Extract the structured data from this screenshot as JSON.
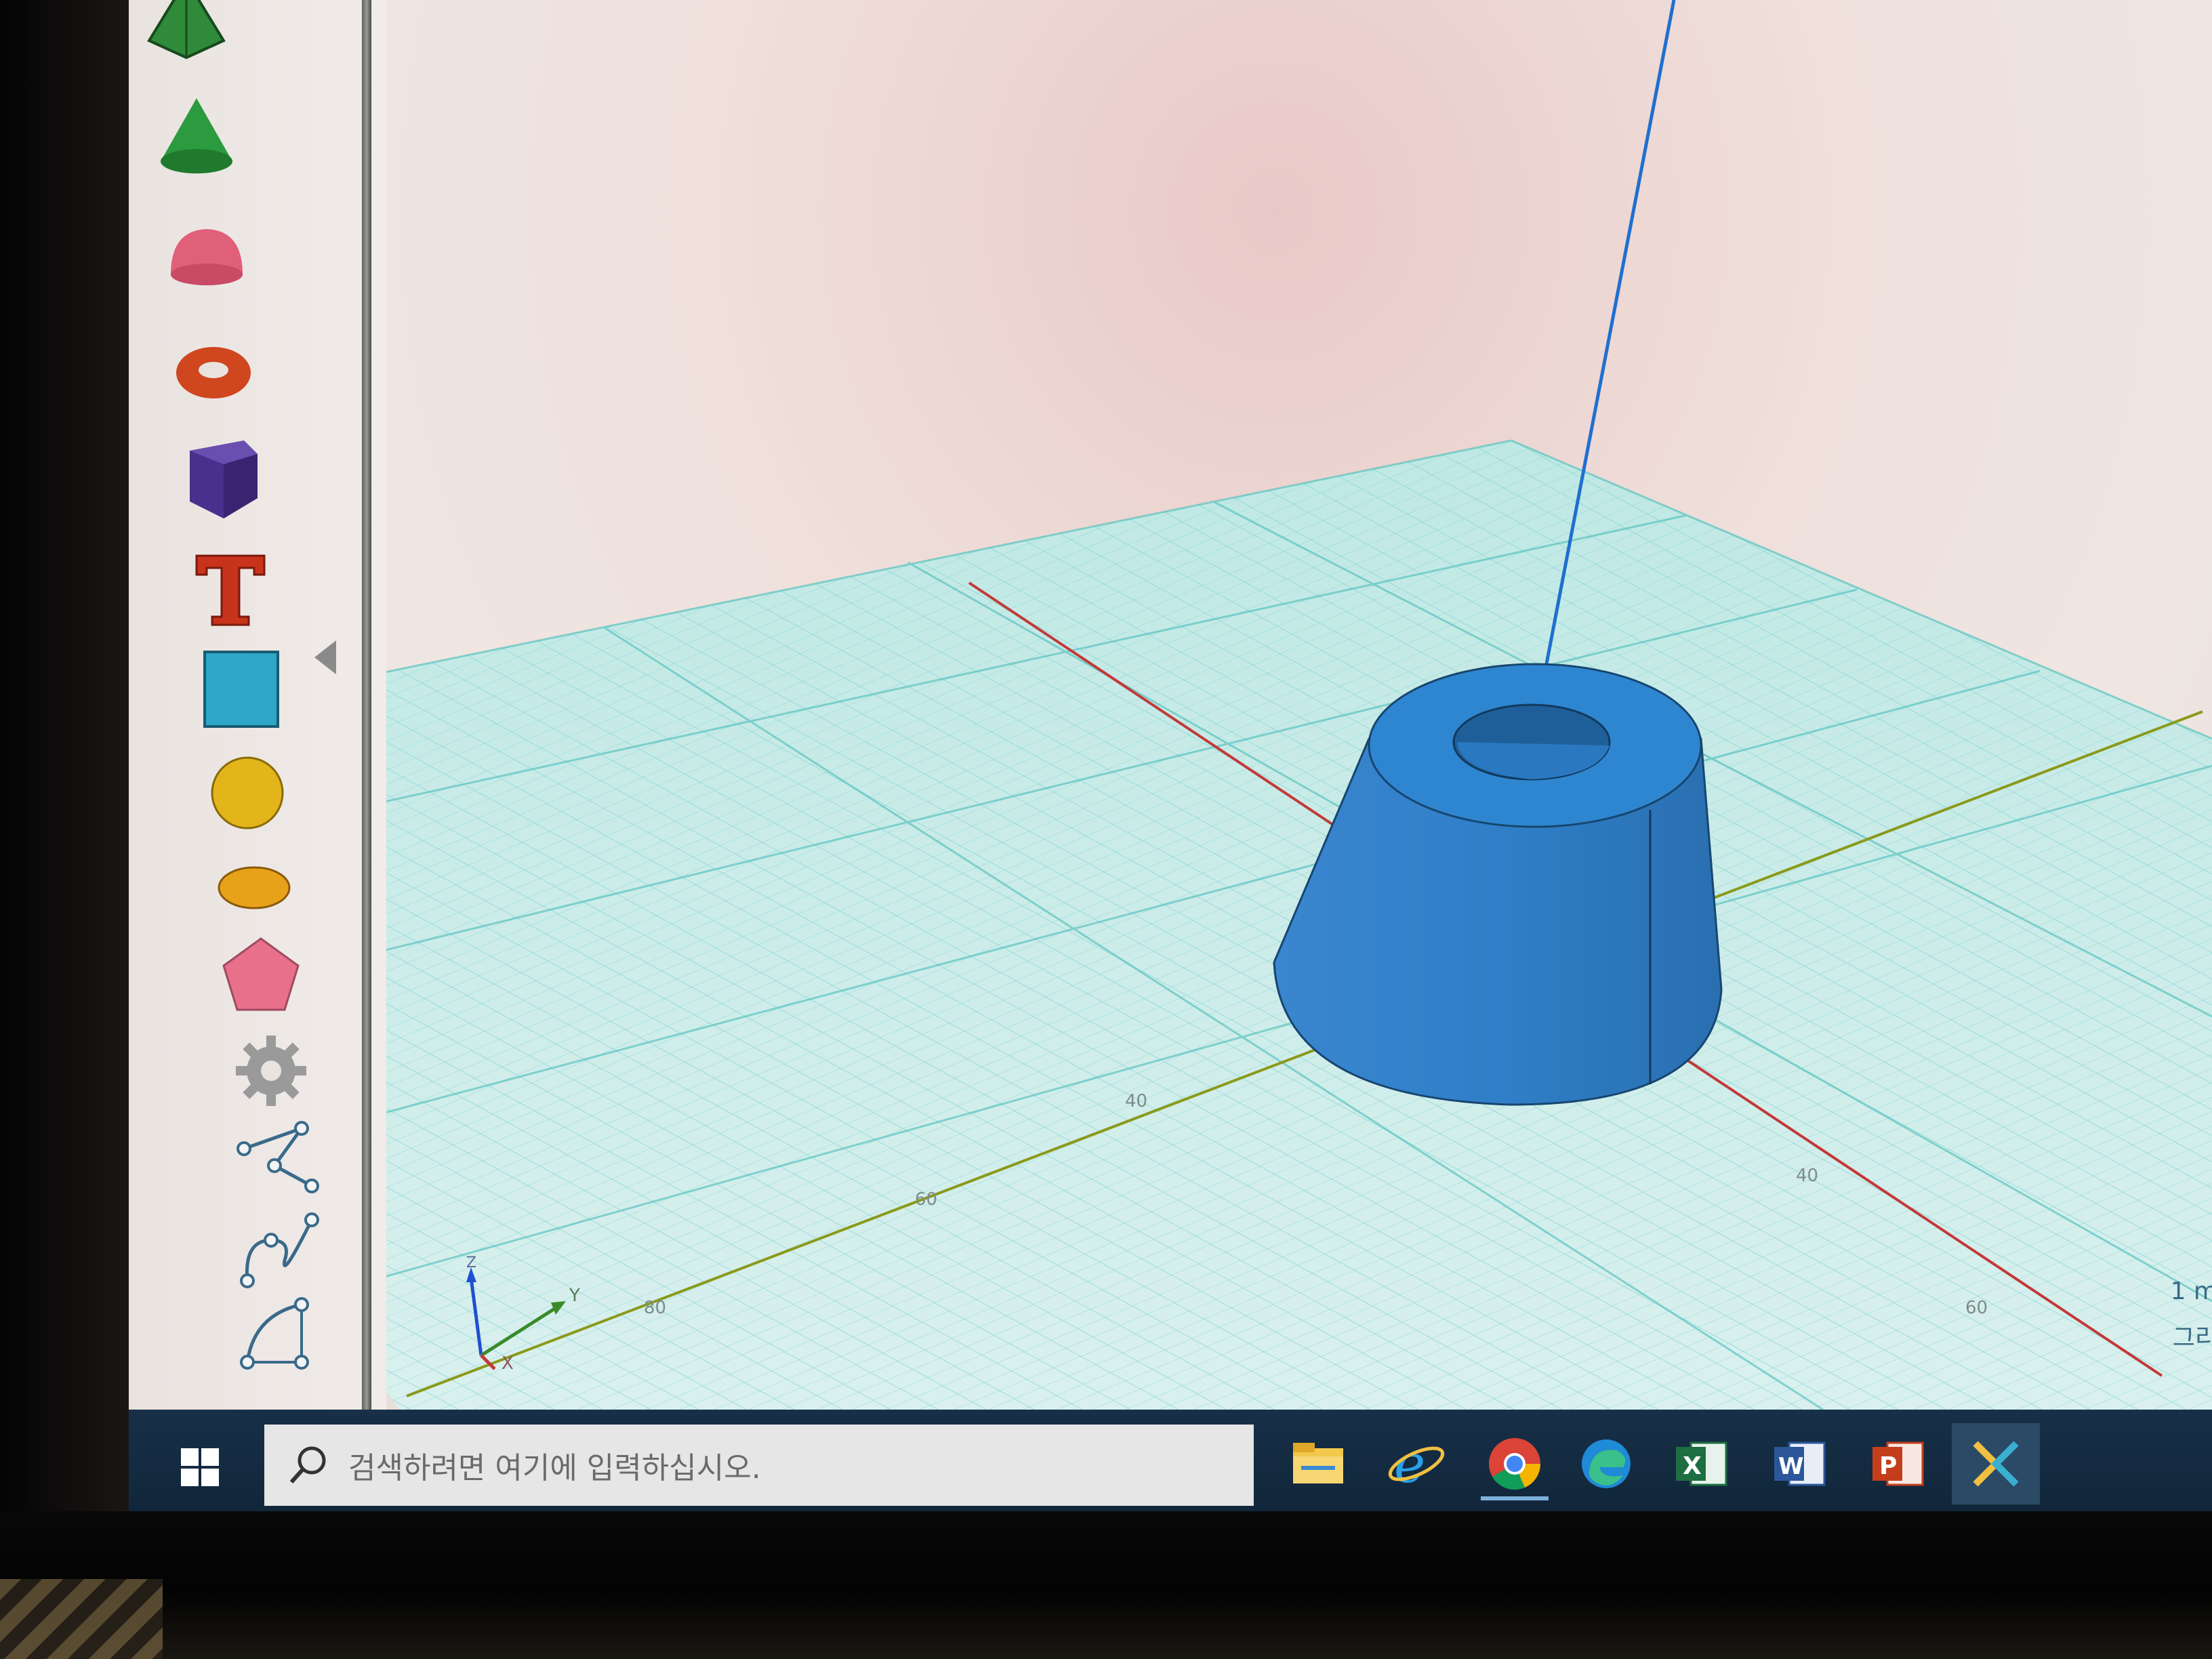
{
  "app": {
    "accent_color": "#2f7fc8",
    "grid_color": "#7fd4d0",
    "viewport_background": "#efe4e0"
  },
  "toolbar": {
    "items": [
      {
        "name": "pyramid-icon",
        "color": "#2f8a3a"
      },
      {
        "name": "cone-icon",
        "color": "#2c9a3e"
      },
      {
        "name": "half-sphere-icon",
        "color": "#e0607a"
      },
      {
        "name": "torus-icon",
        "color": "#d0461e"
      },
      {
        "name": "box-icon",
        "color": "#4a2f8c"
      },
      {
        "name": "text-icon",
        "color": "#c8331b"
      },
      {
        "name": "square-icon",
        "color": "#2ea7c8"
      },
      {
        "name": "circle-icon",
        "color": "#e2b51a"
      },
      {
        "name": "ellipse-icon",
        "color": "#e8a21a"
      },
      {
        "name": "pentagon-icon",
        "color": "#e8708a"
      },
      {
        "name": "gear-icon",
        "color": "#9a9a9a"
      },
      {
        "name": "polyline-icon",
        "color": "#3a6a8a"
      },
      {
        "name": "spline-icon",
        "color": "#3a6a8a"
      },
      {
        "name": "arc-icon",
        "color": "#3a6a8a"
      }
    ]
  },
  "viewport": {
    "axis_labels": {
      "x": "X",
      "y": "Y",
      "z": "Z"
    },
    "floor_ticks": [
      "40",
      "60",
      "80",
      "40",
      "60"
    ],
    "object": {
      "shape": "truncated-cone-with-hole",
      "color": "#2f7fc8"
    }
  },
  "edge_status": {
    "scale": "1 m",
    "grid": "그리"
  },
  "taskbar": {
    "search_placeholder": "검색하려면 여기에 입력하십시오.",
    "apps": [
      {
        "name": "file-explorer-icon"
      },
      {
        "name": "internet-explorer-icon"
      },
      {
        "name": "chrome-icon"
      },
      {
        "name": "edge-icon"
      },
      {
        "name": "excel-icon",
        "letter": "X"
      },
      {
        "name": "word-icon",
        "letter": "W"
      },
      {
        "name": "powerpoint-icon",
        "letter": "P"
      },
      {
        "name": "app-icon"
      }
    ]
  }
}
